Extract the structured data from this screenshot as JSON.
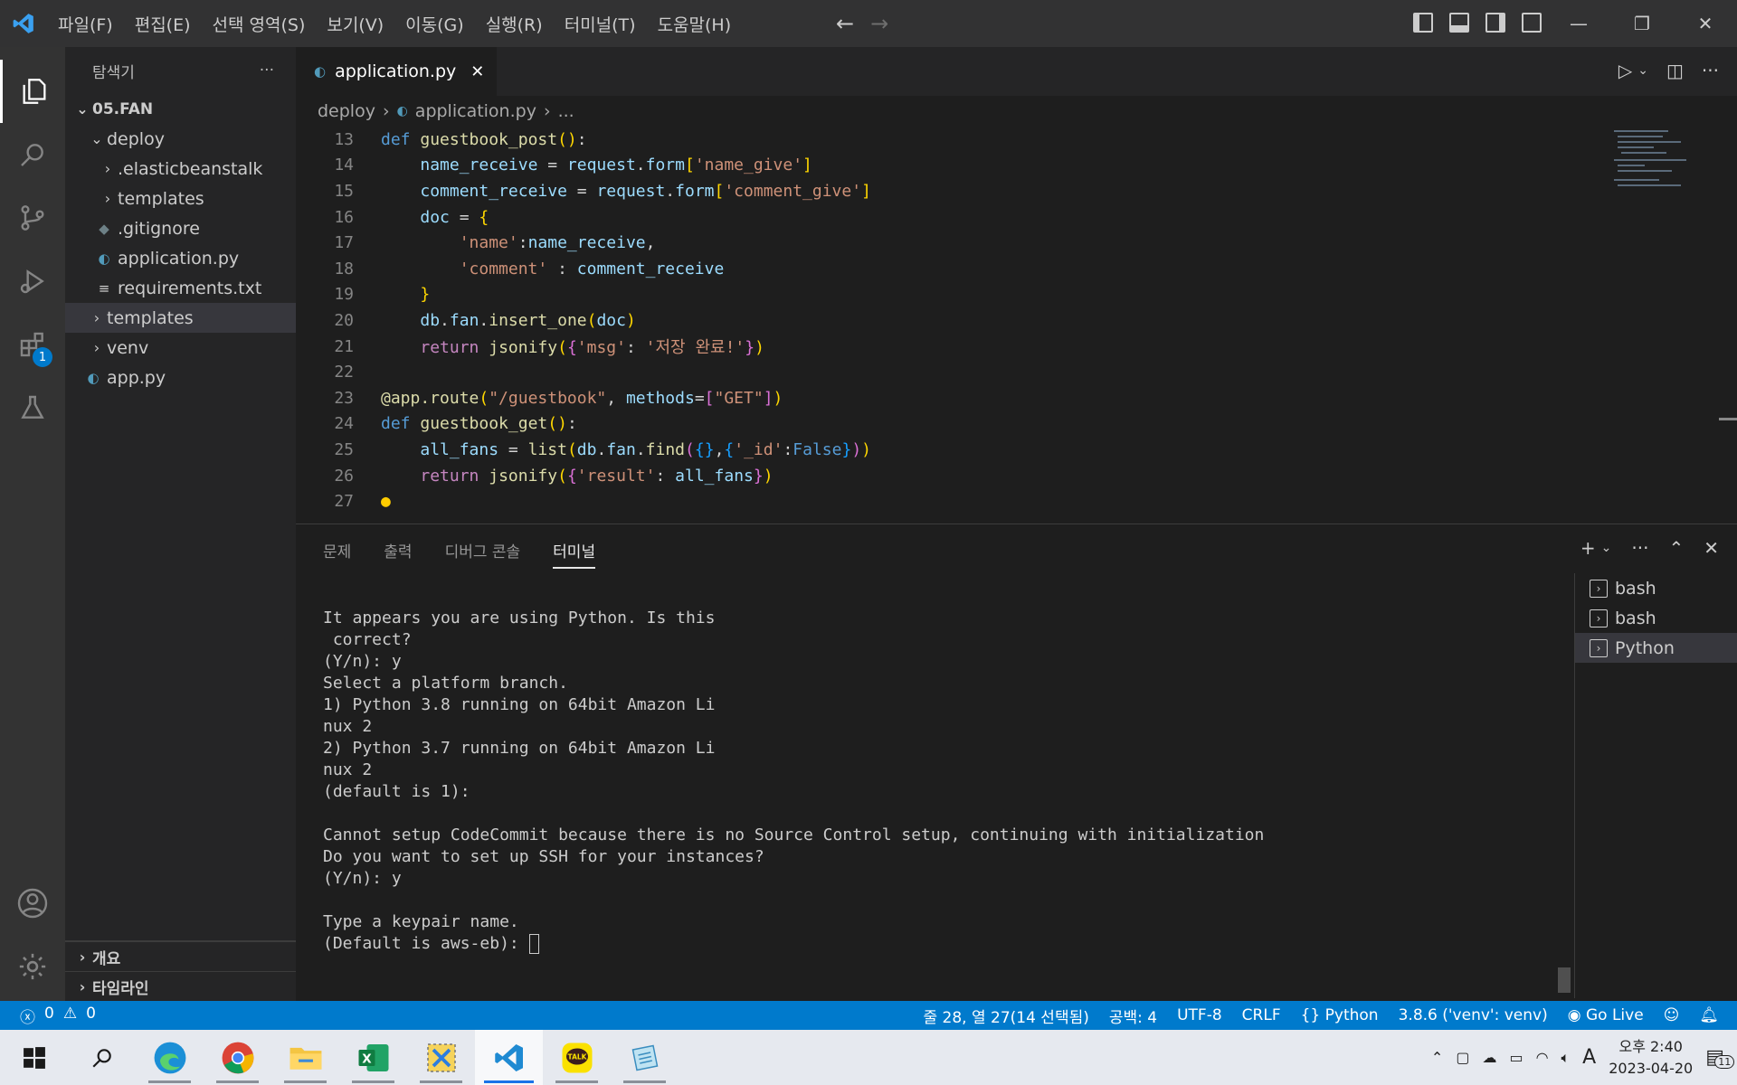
{
  "menu": [
    "파일(F)",
    "편집(E)",
    "선택 영역(S)",
    "보기(V)",
    "이동(G)",
    "실행(R)",
    "터미널(T)",
    "도움말(H)"
  ],
  "sidebar": {
    "title": "탐색기",
    "root": "05.FAN",
    "items": [
      {
        "label": "deploy",
        "type": "folder-open",
        "indent": 1
      },
      {
        "label": ".elasticbeanstalk",
        "type": "folder",
        "indent": 2
      },
      {
        "label": "templates",
        "type": "folder",
        "indent": 2
      },
      {
        "label": ".gitignore",
        "type": "gitignore",
        "indent": 2
      },
      {
        "label": "application.py",
        "type": "python",
        "indent": 2
      },
      {
        "label": "requirements.txt",
        "type": "text",
        "indent": 2
      },
      {
        "label": "templates",
        "type": "folder",
        "indent": 1,
        "selected": true
      },
      {
        "label": "venv",
        "type": "folder",
        "indent": 1
      },
      {
        "label": "app.py",
        "type": "python",
        "indent": 1
      }
    ],
    "bottom": [
      "개요",
      "타임라인"
    ]
  },
  "activity_badge": "1",
  "editor": {
    "tab_label": "application.py",
    "breadcrumb": [
      "deploy",
      "application.py",
      "..."
    ],
    "line_numbers": [
      "13",
      "14",
      "15",
      "16",
      "17",
      "18",
      "19",
      "20",
      "21",
      "22",
      "23",
      "24",
      "25",
      "26",
      "27"
    ]
  },
  "panel": {
    "tabs": [
      "문제",
      "출력",
      "디버그 콘솔",
      "터미널"
    ],
    "active_tab": "터미널",
    "terminal_lines": [
      "It appears you are using Python. Is this",
      " correct?",
      "(Y/n): y",
      "Select a platform branch.",
      "1) Python 3.8 running on 64bit Amazon Li",
      "nux 2",
      "2) Python 3.7 running on 64bit Amazon Li",
      "nux 2",
      "(default is 1):",
      "",
      "Cannot setup CodeCommit because there is no Source Control setup, continuing with initialization",
      "Do you want to set up SSH for your instances?",
      "(Y/n): y",
      "",
      "Type a keypair name."
    ],
    "prompt": "(Default is aws-eb): ",
    "terminals": [
      "bash",
      "bash",
      "Python"
    ]
  },
  "status": {
    "errors": "0",
    "warnings": "0",
    "position": "줄 28, 열 27(14 선택됨)",
    "spaces": "공백: 4",
    "encoding": "UTF-8",
    "eol": "CRLF",
    "language": "Python",
    "interpreter": "3.8.6 ('venv': venv)",
    "golive": "Go Live"
  },
  "taskbar": {
    "time": "오후 2:40",
    "date": "2023-04-20",
    "ime": "A",
    "notif_count": "11"
  }
}
